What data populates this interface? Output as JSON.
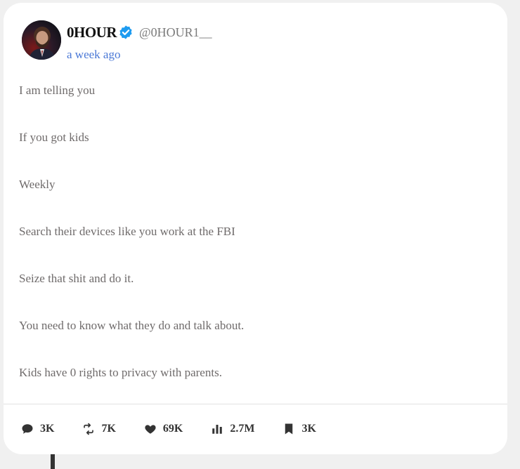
{
  "author": {
    "name": "0HOUR",
    "handle": "@0HOUR1__",
    "verified": true,
    "avatar_icon": "profile-photo"
  },
  "post": {
    "timestamp": "a week ago",
    "lines": [
      "I am telling you",
      "If you got kids",
      "Weekly",
      "Search their devices like you work at the FBI",
      "Seize that shit and do it.",
      "You need to know what they do and talk about.",
      "Kids have 0 rights to privacy with parents."
    ]
  },
  "stats": {
    "replies": "3K",
    "reposts": "7K",
    "likes": "69K",
    "views": "2.7M",
    "bookmarks": "3K"
  },
  "colors": {
    "accent": "#4a78d6",
    "verified": "#1d9bf0",
    "text": "#6f6b6b",
    "icon": "#333333"
  }
}
